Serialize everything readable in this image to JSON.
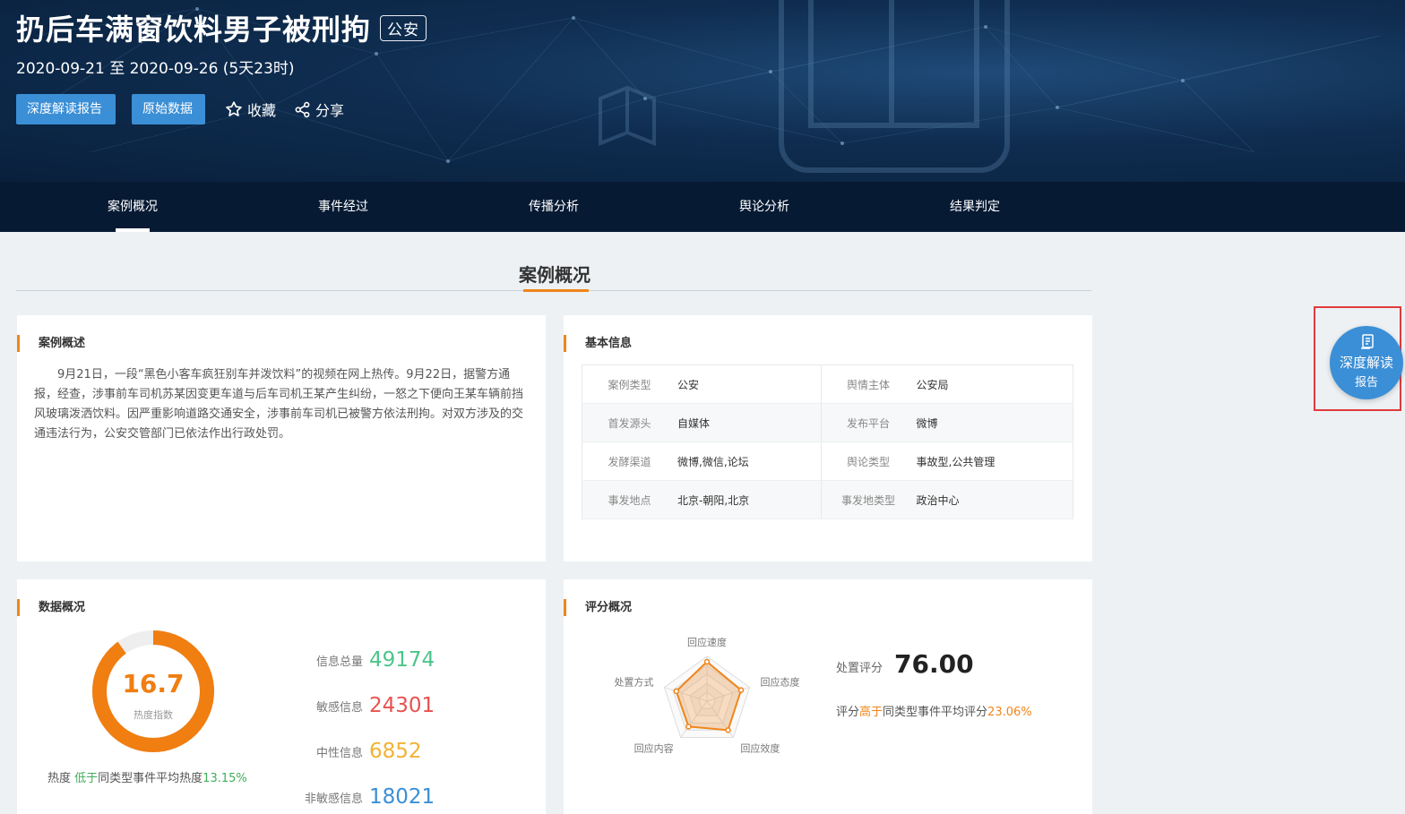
{
  "header": {
    "title": "扔后车满窗饮料男子被刑拘",
    "tag": "公安",
    "date_range": "2020-09-21 至 2020-09-26 (5天23时)",
    "btn_report": "深度解读报告",
    "btn_raw": "原始数据",
    "favorite": "收藏",
    "share": "分享"
  },
  "nav": {
    "items": [
      "案例概况",
      "事件经过",
      "传播分析",
      "舆论分析",
      "结果判定"
    ],
    "active": "案例概况"
  },
  "section": {
    "title": "案例概况"
  },
  "overview": {
    "title": "案例概述",
    "text": "9月21日，一段“黑色小客车疯狂别车并泼饮料”的视频在网上热传。9月22日，据警方通报，经查，涉事前车司机苏某因变更车道与后车司机王某产生纠纷，一怒之下便向王某车辆前挡风玻璃泼洒饮料。因严重影响道路交通安全，涉事前车司机已被警方依法刑拘。对双方涉及的交通违法行为，公安交管部门已依法作出行政处罚。"
  },
  "basic": {
    "title": "基本信息",
    "rows": [
      [
        {
          "k": "案例类型",
          "v": "公安"
        },
        {
          "k": "舆情主体",
          "v": "公安局"
        }
      ],
      [
        {
          "k": "首发源头",
          "v": "自媒体"
        },
        {
          "k": "发布平台",
          "v": "微博"
        }
      ],
      [
        {
          "k": "发酵渠道",
          "v": "微博,微信,论坛"
        },
        {
          "k": "舆论类型",
          "v": "事故型,公共管理"
        }
      ],
      [
        {
          "k": "事发地点",
          "v": "北京-朝阳,北京"
        },
        {
          "k": "事发地类型",
          "v": "政治中心"
        }
      ]
    ]
  },
  "data_overview": {
    "title": "数据概况",
    "heat_value": "16.7",
    "heat_fraction": 0.167,
    "heat_label": "热度指数",
    "heat_note_prefix": "热度 ",
    "heat_note_compare": "低于",
    "heat_note_mid": "同类型事件平均热度",
    "heat_note_pct": "13.15%",
    "stats": [
      {
        "label": "信息总量",
        "value": "49174",
        "color": "#4cc58a"
      },
      {
        "label": "敏感信息",
        "value": "24301",
        "color": "#e8524f"
      },
      {
        "label": "中性信息",
        "value": "6852",
        "color": "#f2b233"
      },
      {
        "label": "非敏感信息",
        "value": "18021",
        "color": "#3b8fd6"
      }
    ]
  },
  "score": {
    "title": "评分概况",
    "axes": [
      "回应速度",
      "回应态度",
      "回应效度",
      "回应内容",
      "处置方式"
    ],
    "values": [
      0.88,
      0.8,
      0.8,
      0.7,
      0.72
    ],
    "score_label": "处置评分",
    "score_value": "76.00",
    "note_prefix": "评分",
    "note_compare": "高于",
    "note_mid": "同类型事件平均评分",
    "note_pct": "23.06%",
    "accent": "#f08519"
  },
  "float": {
    "line1": "深度解读",
    "line2": "报告"
  }
}
